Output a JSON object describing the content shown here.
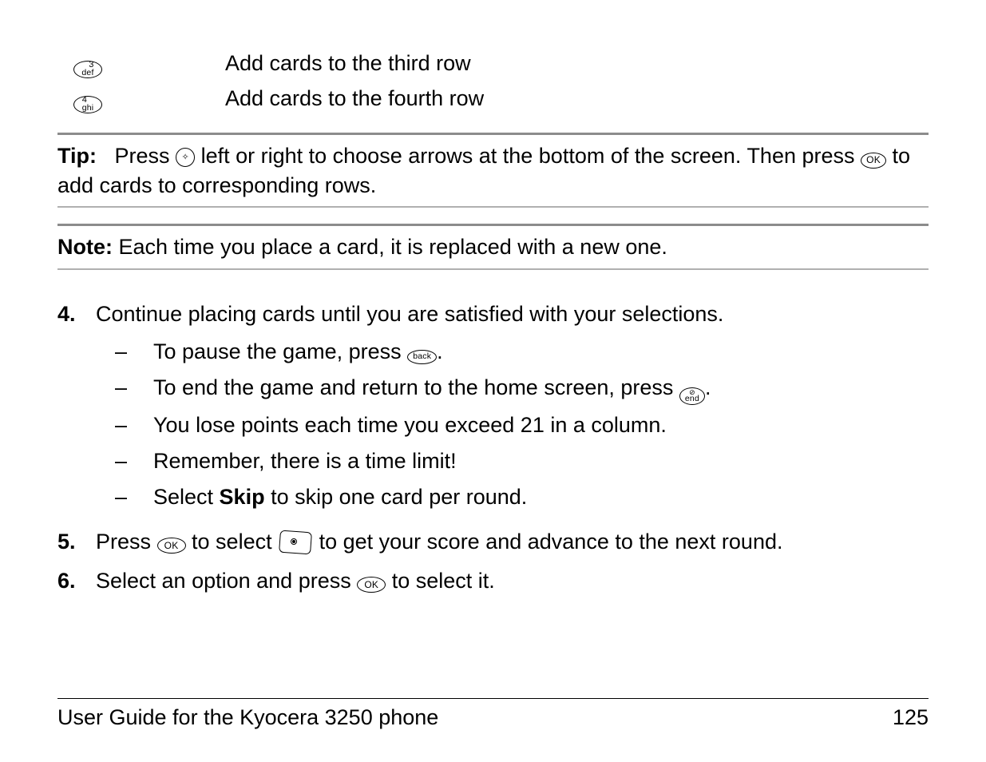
{
  "key_rows": [
    {
      "icon": {
        "top": "3",
        "bottom": "def"
      },
      "name": "key-3-def",
      "text": "Add cards to the third row"
    },
    {
      "icon": {
        "top": "4",
        "bottom": "ghi"
      },
      "name": "key-4-ghi",
      "text": "Add cards to the fourth row"
    }
  ],
  "tip": {
    "label": "Tip:",
    "text_before": "Press",
    "nav_icon_name": "navigation-key-icon",
    "text_mid": "left or right to choose arrows at the bottom of the screen. Then press",
    "ok_icon_name": "ok-key-icon",
    "text_after": "to add cards to corresponding rows."
  },
  "note": {
    "label": "Note:",
    "text": "Each time you place a card, it is replaced with a new one."
  },
  "steps": [
    {
      "num": "4.",
      "body": "Continue placing cards until you are satisfied with your selections.",
      "subs": [
        {
          "parts": [
            {
              "t": "To pause the game, press "
            },
            {
              "icon": "back",
              "name": "back-key-icon"
            },
            {
              "t": "."
            }
          ]
        },
        {
          "parts": [
            {
              "t": "To end the game and return to the home screen, press "
            },
            {
              "icon": "end",
              "name": "end-key-icon"
            },
            {
              "t": "."
            }
          ]
        },
        {
          "parts": [
            {
              "t": "You lose points each time you exceed 21 in a column."
            }
          ]
        },
        {
          "parts": [
            {
              "t": "Remember, there is a time limit!"
            }
          ]
        },
        {
          "parts": [
            {
              "t": "Select "
            },
            {
              "bold": "Skip"
            },
            {
              "t": " to skip one card per round."
            }
          ]
        }
      ]
    },
    {
      "num": "5.",
      "parts": [
        {
          "t": "Press "
        },
        {
          "icon": "ok",
          "name": "ok-key-icon"
        },
        {
          "t": " to select "
        },
        {
          "eyecard": true,
          "name": "score-card-icon"
        },
        {
          "t": " to get your score and advance to the next round."
        }
      ]
    },
    {
      "num": "6.",
      "parts": [
        {
          "t": "Select an option and press "
        },
        {
          "icon": "ok",
          "name": "ok-key-icon"
        },
        {
          "t": " to select it."
        }
      ]
    }
  ],
  "footer": {
    "title": "User Guide for the Kyocera 3250 phone",
    "page": "125"
  },
  "icon_labels": {
    "ok": "OK",
    "back": "back",
    "end_top": "⊘",
    "end_bottom": "end"
  }
}
